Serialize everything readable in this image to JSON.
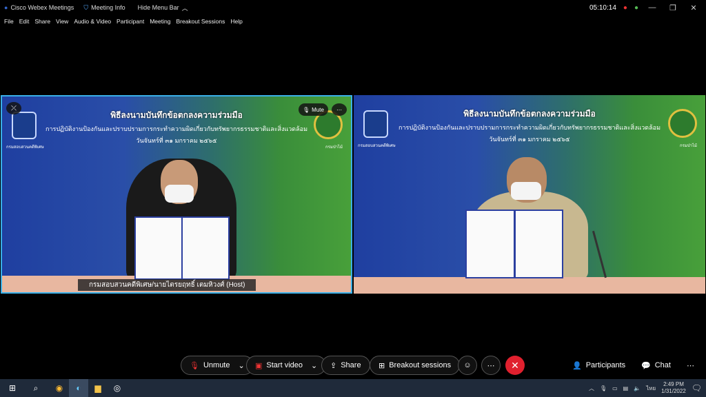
{
  "titlebar": {
    "app": "Cisco Webex Meetings",
    "meeting_info": "Meeting Info",
    "hide_menu": "Hide Menu Bar",
    "time": "05:10:14"
  },
  "menu": [
    "File",
    "Edit",
    "Share",
    "View",
    "Audio & Video",
    "Participant",
    "Meeting",
    "Breakout Sessions",
    "Help"
  ],
  "video1": {
    "title": "พิธีลงนามบันทึกข้อตกลงความร่วมมือ",
    "subtitle": "การปฏิบัติงานป้องกันและปราบปรามการกระทำความผิดเกี่ยวกับทรัพยากรธรรมชาติและสิ่งแวดล้อม",
    "date": "วันจันทร์ที่ ๓๑ มกราคม ๒๕๖๕",
    "left_caption": "กรมสอบสวนคดีพิเศษ",
    "right_caption": "กรมป่าไม้",
    "name_label": "กรมสอบสวนคดีพิเศษ/นายไตรยฤทธิ์ เตมหิวงศ์  (Host)",
    "mute_label": "Mute"
  },
  "video2": {
    "title": "พิธีลงนามบันทึกข้อตกลงความร่วมมือ",
    "subtitle": "การปฏิบัติงานป้องกันและปราบปรามการกระทำความผิดเกี่ยวกับทรัพยากรธรรมชาติและสิ่งแวดล้อม",
    "date": "วันจันทร์ที่ ๓๑ มกราคม ๒๕๖๕",
    "left_caption": "กรมสอบสวนคดีพิเศษ",
    "right_caption": "กรมป่าไม้"
  },
  "controls": {
    "unmute": "Unmute",
    "start_video": "Start video",
    "share": "Share",
    "breakout": "Breakout sessions",
    "participants": "Participants",
    "chat": "Chat"
  },
  "tray": {
    "lang": "ไทย",
    "time": "2:49 PM",
    "date": "1/31/2022"
  },
  "colors": {
    "end_call": "#e0202e",
    "active_border": "#3ab0e8"
  }
}
